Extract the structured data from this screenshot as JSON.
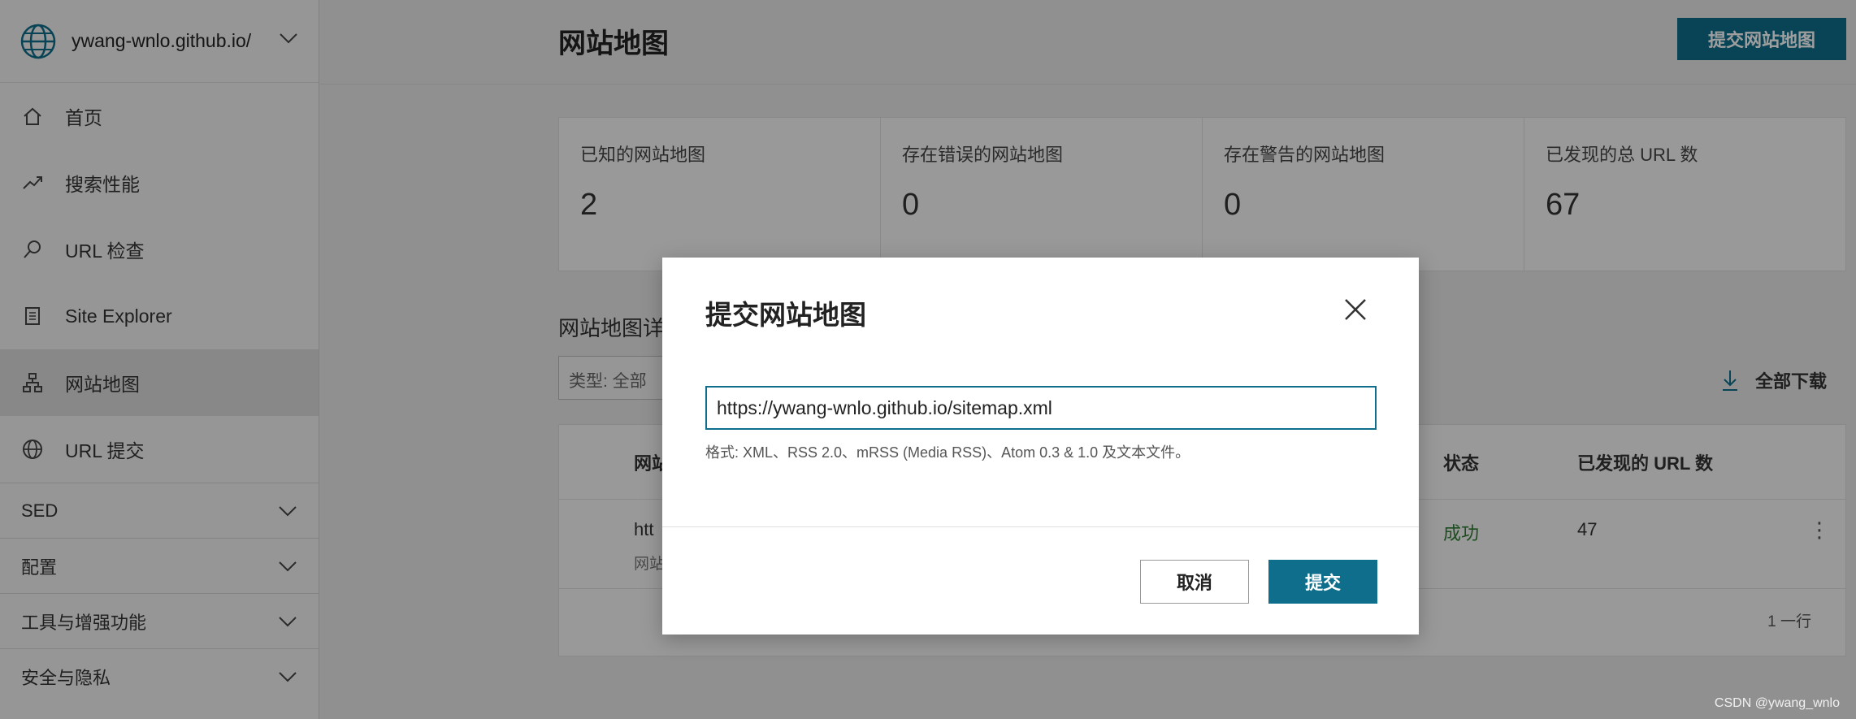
{
  "sidebar": {
    "site": "ywang-wnlo.github.io/",
    "items": [
      {
        "label": "首页",
        "icon": "home-icon"
      },
      {
        "label": "搜索性能",
        "icon": "trend-icon"
      },
      {
        "label": "URL 检查",
        "icon": "search-icon"
      },
      {
        "label": "Site Explorer",
        "icon": "document-icon"
      },
      {
        "label": "网站地图",
        "icon": "sitemap-icon",
        "active": true
      },
      {
        "label": "URL 提交",
        "icon": "globe-icon"
      }
    ],
    "groups": [
      "SED",
      "配置",
      "工具与增强功能",
      "安全与隐私"
    ]
  },
  "header": {
    "title": "网站地图",
    "submit_button": "提交网站地图"
  },
  "stats": [
    {
      "label": "已知的网站地图",
      "value": "2"
    },
    {
      "label": "存在错误的网站地图",
      "value": "0"
    },
    {
      "label": "存在警告的网站地图",
      "value": "0"
    },
    {
      "label": "已发现的总 URL 数",
      "value": "67"
    }
  ],
  "details": {
    "title": "网站地图详",
    "filter": "类型: 全部",
    "download": "全部下载"
  },
  "table": {
    "headers": {
      "name": "网站",
      "status": "状态",
      "urls": "已发现的 URL 数"
    },
    "rows": [
      {
        "url": "htt",
        "sub": "网站",
        "status": "成功",
        "urls": "47"
      }
    ],
    "footer": "1 一行"
  },
  "dialog": {
    "title": "提交网站地图",
    "input_value": "https://ywang-wnlo.github.io/sitemap.xml",
    "hint": "格式: XML、RSS 2.0、mRSS (Media RSS)、Atom 0.3 & 1.0 及文本文件。",
    "cancel": "取消",
    "submit": "提交"
  },
  "watermark": "CSDN @ywang_wnlo",
  "colors": {
    "accent": "#0e6e8c",
    "success": "#2e7d32"
  }
}
